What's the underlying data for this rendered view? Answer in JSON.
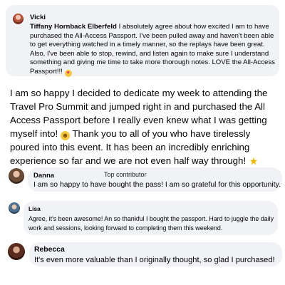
{
  "quoted_comment": {
    "author": "Vicki",
    "tagged_name": "Tiffany Hornback Elberfeld",
    "text": " I absolutely agree about how excited I am to have purchased the All-Access Passport. I've been pulled away and haven't been able to get everything watched in a timely manner, so the replays have been great. Also, I've been able to stop, rewind, and listen again to make sure I understand something and giving me time to take more thorough notes. LOVE the All-Access Passport!!! ",
    "emoji": "heart-eyes-emoji"
  },
  "main_post": {
    "text_part1": "I am so happy I decided to dedicate my week to attending the Travel Pro Summit and jumped right in and purchased the All Access Passport before I really even knew what I was getting myself into! ",
    "emoji1": "rofl-emoji",
    "text_part2": " Thank you to all of you who have tirelessly poured into this event. It has been an incredibly enriching experience so far and we are not even half way through! ",
    "emoji2": "star-emoji"
  },
  "comments": [
    {
      "author": "Danna",
      "badge": "Top contributor",
      "text": "I am so happy to have bought the pass! I am so grateful for this opportunity."
    },
    {
      "author": "Lisa",
      "text": "Agree, it's been awesome! An so thankful I bought the passport. Hard to juggle the daily work and sessions, looking forward to completing them this weekend."
    },
    {
      "author": "Rebecca",
      "text": "It's even more valuable than I originally thought, so glad I purchased!"
    }
  ]
}
